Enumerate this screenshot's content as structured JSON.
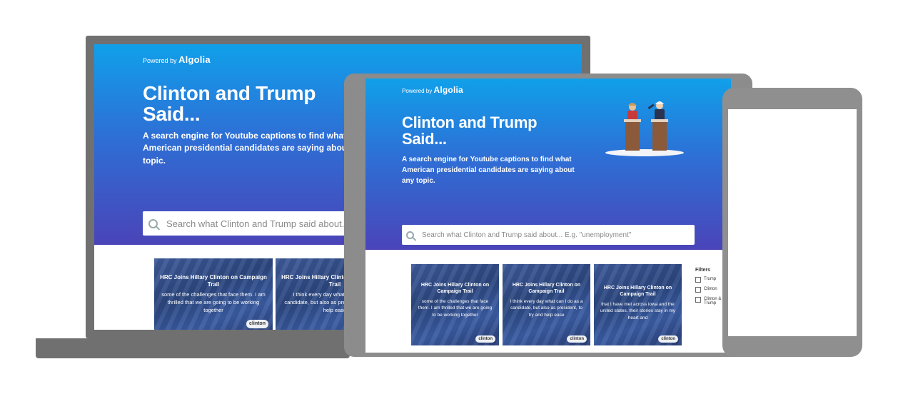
{
  "brand": {
    "powered_by": "Powered by",
    "name": "Algolia"
  },
  "hero": {
    "title": "Clinton and Trump Said...",
    "subtitle": "A search engine for Youtube captions to find what American presidential candidates are saying about any topic."
  },
  "laptop": {
    "subtitle_visible": "A search engine for Youtube captions to find what American presidential candidates are saying about any topic.",
    "search_placeholder": "Search what Clinton and Trump said about..."
  },
  "tablet": {
    "search_placeholder": "Search what Clinton and Trump said about...  E.g. \"unemployment\""
  },
  "cards": [
    {
      "title": "HRC Joins Hillary Clinton on Campaign Trail",
      "text": "some of the challenges that face them. I am thrilled that we are going to be working together",
      "tag": "clinton"
    },
    {
      "title": "HRC Joins Hillary Clinton on Campaign Trail",
      "text": "I think every day what can I do as a candidate, but also as president, to try and help ease",
      "tag": "clinton"
    },
    {
      "title": "HRC Joins Hillary Clinton on Campaign Trail",
      "text": "that I have met across iowa and the united states. their stories stay in my heart and",
      "tag": "clinton"
    }
  ],
  "filters": {
    "title": "Filters",
    "options": [
      "Trump",
      "Clinton",
      "Clinton & Trump"
    ]
  },
  "colors": {
    "gradient_top": "#10a0ea",
    "gradient_bottom": "#4a44b8",
    "frame": "#707070"
  }
}
